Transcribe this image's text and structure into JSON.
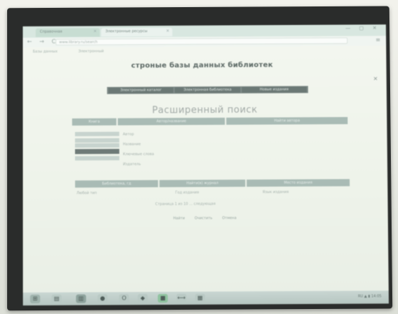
{
  "browser": {
    "tabs": [
      {
        "label": "Справочная"
      },
      {
        "label": "Электронные ресурсы"
      }
    ],
    "tab_close_glyph": "×",
    "window_controls": "— ▢ ✕",
    "nav_glyphs": "← → C",
    "url": "www.library.ru/search",
    "menu_glyph": "≡",
    "bookmarks": [
      "Базы данных",
      "Электронный",
      "Каталог"
    ]
  },
  "page": {
    "site_title": "строные базы данных библиотек",
    "close_glyph": "✕",
    "topnav": [
      "Электронный каталог",
      "Электронная библиотека",
      "Новые издания"
    ],
    "heading": "Расширенный поиск",
    "table1_headers": [
      "Книга",
      "Автор/название",
      "Найти автора"
    ],
    "fields": [
      "Автор",
      "Название",
      "Ключевые слова",
      "Издатель"
    ],
    "table2_headers": [
      "Библиотека, гд",
      "Найти(в) журнал",
      "Место издания"
    ],
    "row2": [
      "Любой тип",
      "Год издания",
      "Язык издания"
    ],
    "pager": "Страница 1 из 10 ... следующая",
    "actions": [
      "Найти",
      "Очистить",
      "Отмена"
    ]
  },
  "taskbar": {
    "icons": [
      "start-icon",
      "explorer-icon",
      "browser-icon",
      "media-icon",
      "opera-icon",
      "app-icon",
      "green-app-icon",
      "network-icon",
      "app2-icon"
    ],
    "tray_text": "RU ▲ ▮ 14:05"
  }
}
